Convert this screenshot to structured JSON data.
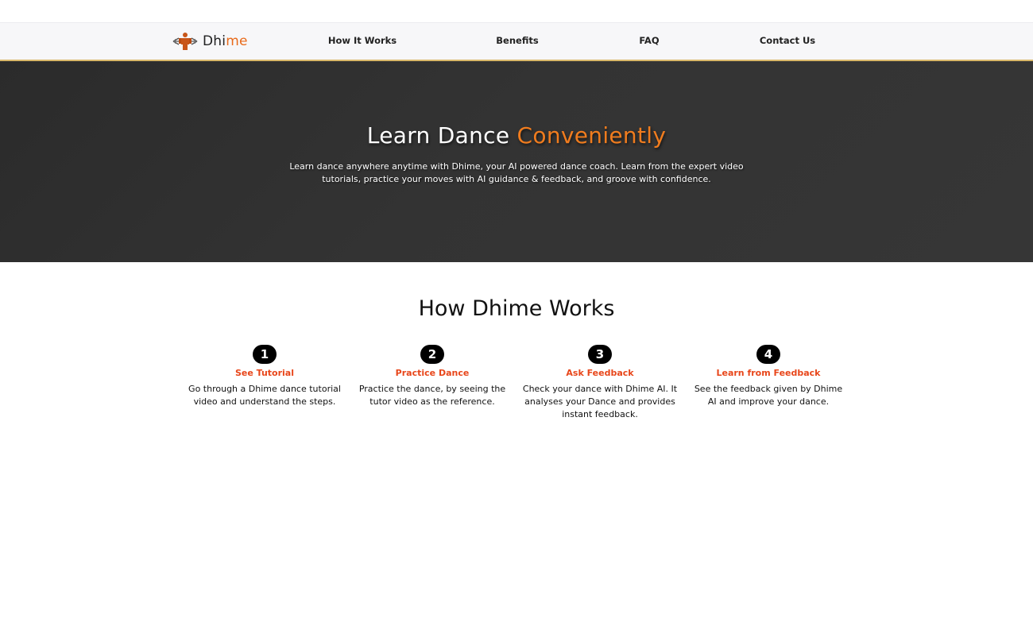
{
  "brand": {
    "name_part1": "Dhi",
    "name_part2": "me",
    "logo_icon": "dancer-figure-icon",
    "accent_color": "#e86a1a"
  },
  "nav": {
    "items": [
      {
        "label": "How It Works"
      },
      {
        "label": "Benefits"
      },
      {
        "label": "FAQ"
      },
      {
        "label": "Contact Us"
      }
    ]
  },
  "hero": {
    "title_part1": "Learn Dance ",
    "title_part2": "Conveniently",
    "subtitle": "Learn dance anywhere anytime with Dhime, your AI powered dance coach. Learn from the expert video tutorials, practice your moves with AI guidance & feedback, and groove with confidence.",
    "background_color": "#2f2f2f",
    "accent_color": "#f07c1e"
  },
  "how": {
    "title": "How Dhime Works",
    "steps": [
      {
        "number": "1",
        "title": "See Tutorial",
        "text": "Go through a Dhime dance tutorial video and understand the steps."
      },
      {
        "number": "2",
        "title": "Practice Dance",
        "text": "Practice the dance, by seeing the tutor video as the reference."
      },
      {
        "number": "3",
        "title": "Ask Feedback",
        "text": "Check your dance with Dhime AI. It analyses your Dance and provides instant feedback."
      },
      {
        "number": "4",
        "title": "Learn from Feedback",
        "text": "See the feedback given by Dhime AI and improve your dance."
      }
    ],
    "step_title_color": "#e8461a"
  }
}
